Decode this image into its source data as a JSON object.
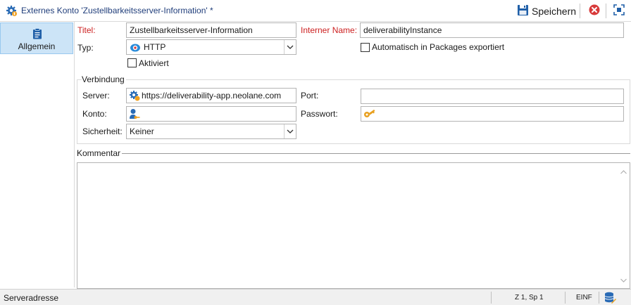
{
  "window": {
    "title": "Externes Konto 'Zustellbarkeitsserver-Information' *",
    "icon": "gear-account-icon"
  },
  "toolbar": {
    "save_label": "Speichern",
    "save_icon": "floppy-disk-icon",
    "close_icon": "close-circle-icon",
    "fullscreen_icon": "fullscreen-icon"
  },
  "nav": {
    "items": [
      {
        "label": "Allgemein",
        "icon": "clipboard-icon",
        "selected": true
      }
    ]
  },
  "form": {
    "title_label": "Titel:",
    "title_value": "Zustellbarkeitsserver-Information",
    "internal_name_label": "Interner Name:",
    "internal_name_value": "deliverabilityInstance",
    "type_label": "Typ:",
    "type_value": "HTTP",
    "activated_label": "Aktiviert",
    "auto_export_label": "Automatisch in Packages exportiert"
  },
  "connection": {
    "group_title": "Verbindung",
    "server_label": "Server:",
    "server_value": "https://deliverability-app.neolane.com",
    "port_label": "Port:",
    "port_value": "",
    "account_label": "Konto:",
    "account_value": "",
    "password_label": "Passwort:",
    "password_value": "",
    "security_label": "Sicherheit:",
    "security_value": "Keiner"
  },
  "comment": {
    "label": "Kommentar",
    "value": ""
  },
  "status": {
    "field_hint": "Serveradresse",
    "cursor_position": "Z 1, Sp 1",
    "insert_mode": "EINF"
  },
  "colors": {
    "title_text": "#1f3d7a",
    "required_label": "#cc1f1f",
    "nav_selected_bg": "#cce4f7",
    "close_red": "#d83b3b",
    "accent_blue": "#2a6bb5",
    "key_gold": "#e8a020"
  }
}
